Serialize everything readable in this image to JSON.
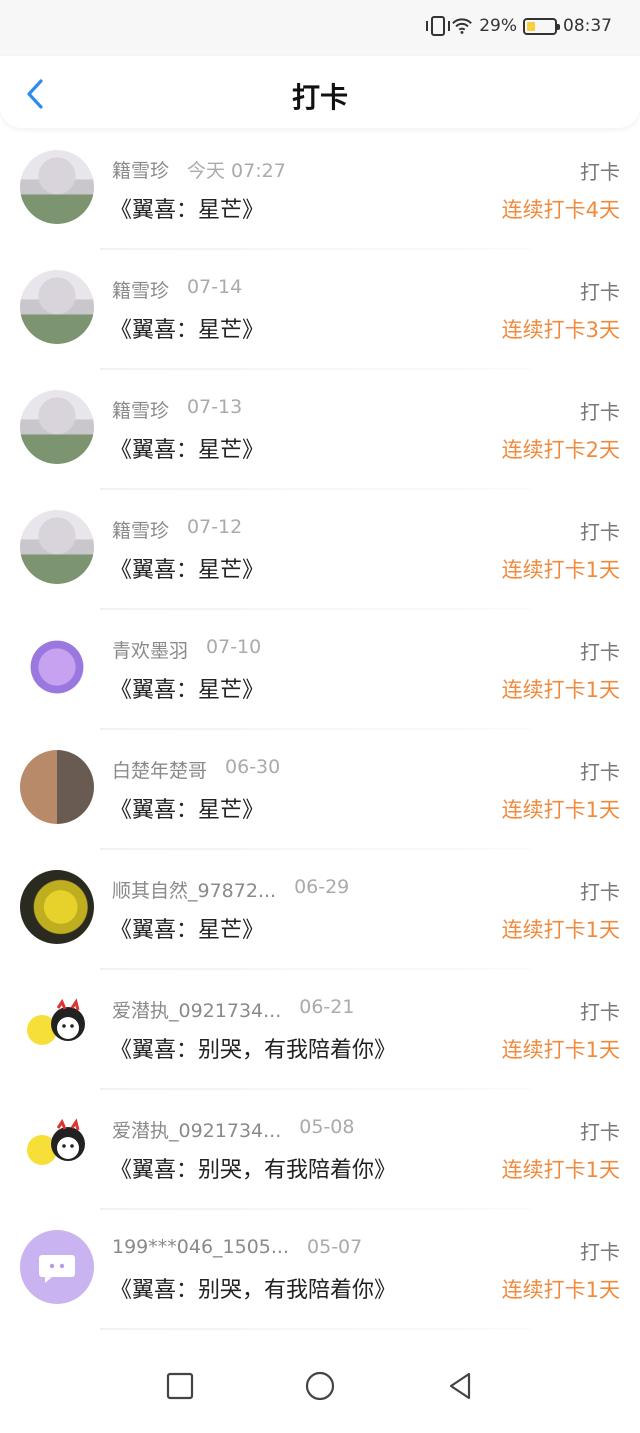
{
  "status_bar": {
    "battery_percent": "29%",
    "time": "08:37",
    "battery_level": 0.29
  },
  "header": {
    "title": "打卡",
    "back_icon": "chevron-left-icon"
  },
  "list": [
    {
      "name": "籍雪珍",
      "date": "今天 07:27",
      "book": "《翼喜：星芒》",
      "action": "打卡",
      "streak": "连续打卡4天",
      "avatar": "girl"
    },
    {
      "name": "籍雪珍",
      "date": "07-14",
      "book": "《翼喜：星芒》",
      "action": "打卡",
      "streak": "连续打卡3天",
      "avatar": "girl"
    },
    {
      "name": "籍雪珍",
      "date": "07-13",
      "book": "《翼喜：星芒》",
      "action": "打卡",
      "streak": "连续打卡2天",
      "avatar": "girl"
    },
    {
      "name": "籍雪珍",
      "date": "07-12",
      "book": "《翼喜：星芒》",
      "action": "打卡",
      "streak": "连续打卡1天",
      "avatar": "girl"
    },
    {
      "name": "青欢墨羽",
      "date": "07-10",
      "book": "《翼喜：星芒》",
      "action": "打卡",
      "streak": "连续打卡1天",
      "avatar": "purple"
    },
    {
      "name": "白楚年楚哥",
      "date": "06-30",
      "book": "《翼喜：星芒》",
      "action": "打卡",
      "streak": "连续打卡1天",
      "avatar": "anime"
    },
    {
      "name": "顺其自然_97872...",
      "date": "06-29",
      "book": "《翼喜：星芒》",
      "action": "打卡",
      "streak": "连续打卡1天",
      "avatar": "flower"
    },
    {
      "name": "爱潜执_0921734...",
      "date": "06-21",
      "book": "《翼喜：别哭，有我陪着你》",
      "action": "打卡",
      "streak": "连续打卡1天",
      "avatar": "cute"
    },
    {
      "name": "爱潜执_0921734...",
      "date": "05-08",
      "book": "《翼喜：别哭，有我陪着你》",
      "action": "打卡",
      "streak": "连续打卡1天",
      "avatar": "cute"
    },
    {
      "name": "199***046_1505...",
      "date": "05-07",
      "book": "《翼喜：别哭，有我陪着你》",
      "action": "打卡",
      "streak": "连续打卡1天",
      "avatar": "chat"
    }
  ],
  "navbar": {
    "recent_icon": "square-icon",
    "home_icon": "circle-icon",
    "back_icon": "triangle-back-icon"
  },
  "colors": {
    "accent": "#f08a3c",
    "back_arrow": "#2f8bf0"
  }
}
